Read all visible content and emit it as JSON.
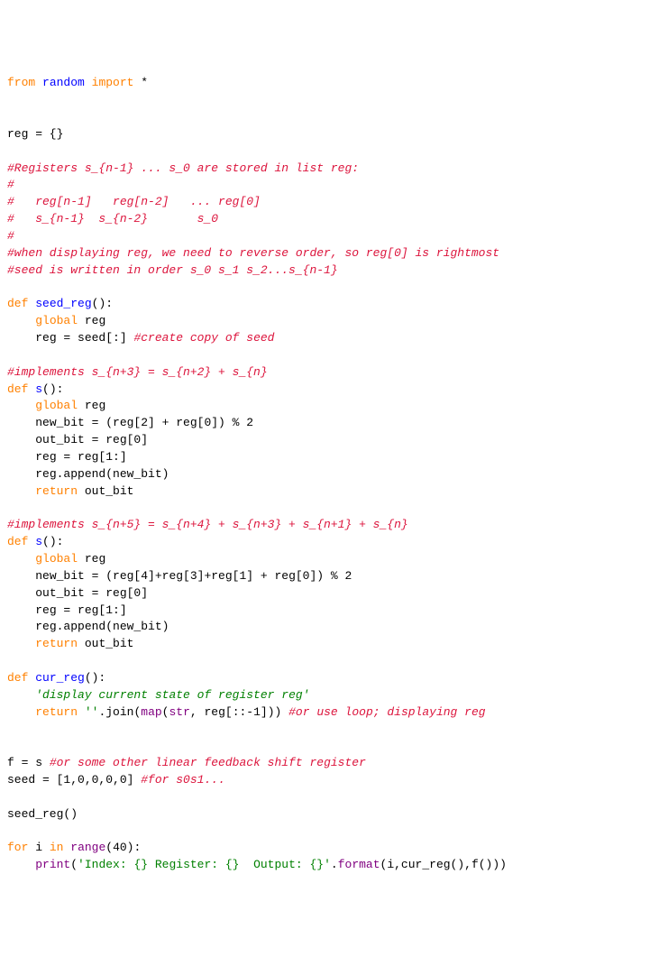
{
  "code": {
    "l01a": "from",
    "l01b": "random",
    "l01c": "import",
    "l01d": "*",
    "l03a": "reg = {}",
    "l05c": "#Registers s_{n-1} ... s_0 are stored in list reg:",
    "l06c": "#",
    "l07c": "#   reg[n-1]   reg[n-2]   ... reg[0]",
    "l08c": "#   s_{n-1}  s_{n-2}       s_0",
    "l09c": "#",
    "l10c": "#when displaying reg, we need to reverse order, so reg[0] is rightmost",
    "l11c": "#seed is written in order s_0 s_1 s_2...s_{n-1}",
    "l13a": "def",
    "l13b": "seed_reg",
    "l13c": "():",
    "l14a": "global",
    "l14b": "reg",
    "l15a": "reg = seed[:]",
    "l15c": "#create copy of seed",
    "l17c": "#implements s_{n+3} = s_{n+2} + s_{n}",
    "l18a": "def",
    "l18b": "s",
    "l18c": "():",
    "l19a": "global",
    "l19b": "reg",
    "l20": "new_bit = (reg[2] + reg[0]) % 2",
    "l21": "out_bit = reg[0]",
    "l22": "reg = reg[1:]",
    "l23": "reg.append(new_bit)",
    "l24a": "return",
    "l24b": "out_bit",
    "l26c": "#implements s_{n+5} = s_{n+4} + s_{n+3} + s_{n+1} + s_{n}",
    "l27a": "def",
    "l27b": "s",
    "l27c": "():",
    "l28a": "global",
    "l28b": "reg",
    "l29": "new_bit = (reg[4]+reg[3]+reg[1] + reg[0]) % 2",
    "l30": "out_bit = reg[0]",
    "l31": "reg = reg[1:]",
    "l32": "reg.append(new_bit)",
    "l33a": "return",
    "l33b": "out_bit",
    "l35a": "def",
    "l35b": "cur_reg",
    "l35c": "():",
    "l36doc": "'display current state of register reg'",
    "l37a": "return",
    "l37b": "''",
    "l37c": ".join(",
    "l37d": "map",
    "l37e": "(",
    "l37f": "str",
    "l37g": ", reg[::-1]))",
    "l37h": "#or use loop; displaying reg",
    "l40a": "f = s",
    "l40c": "#or some other linear feedback shift register",
    "l41a": "seed = [1,0,0,0,0]",
    "l41c": "#for s0s1...",
    "l43": "seed_reg()",
    "l45a": "for",
    "l45b": "i",
    "l45c": "in",
    "l45d": "range",
    "l45e": "(40):",
    "l46a": "print",
    "l46b": "(",
    "l46c": "'Index: {} Register: {}  Output: {}'",
    "l46d": ".",
    "l46e": "format",
    "l46f": "(i,cur_reg(),f()))"
  }
}
